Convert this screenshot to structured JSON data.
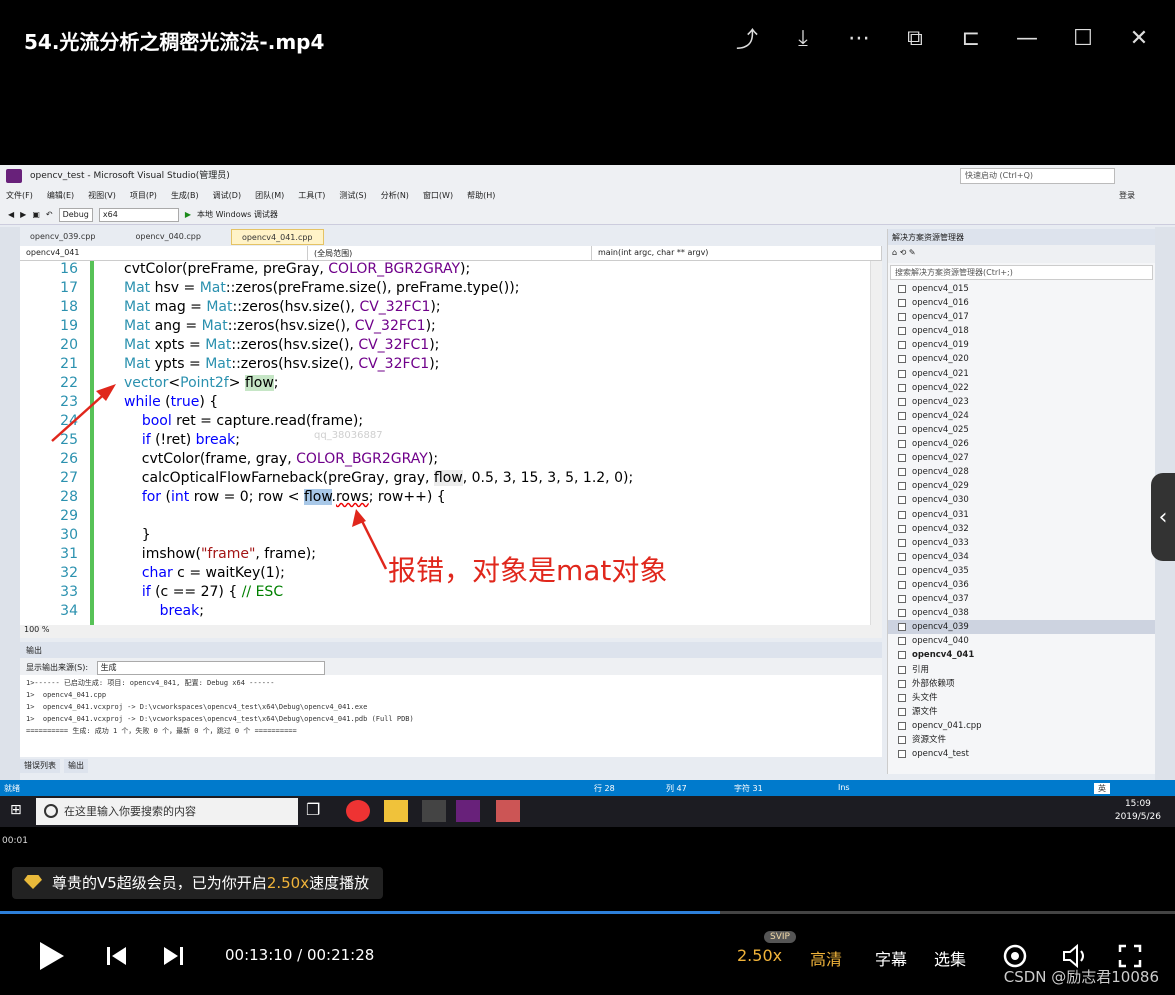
{
  "player": {
    "title": "54.光流分析之稠密光流法-.mp4",
    "icons": [
      "share-icon",
      "download-icon",
      "more-icon",
      "pip-icon",
      "pin-icon",
      "minimize-icon",
      "maximize-icon",
      "close-icon"
    ],
    "current_time": "00:13:10",
    "total_time": "00:21:28",
    "time_display": "00:13:10 / 00:21:28",
    "small_time": "00:01",
    "progress": 0.613,
    "vip_toast_prefix": "尊贵的V5超级会员，已为你开启",
    "vip_toast_speed": "2.50x",
    "vip_toast_suffix": "速度播放",
    "speed_label": "2.50x",
    "svip_badge": "SVIP",
    "quality_label": "高清",
    "subtitle_label": "字幕",
    "episodes_label": "选集",
    "watermark": "CSDN @励志君10086"
  },
  "vs": {
    "window_title": "opencv_test - Microsoft Visual Studio(管理员)",
    "quick_launch": "快速启动 (Ctrl+Q)",
    "login": "登录",
    "menu": [
      "文件(F)",
      "编辑(E)",
      "视图(V)",
      "项目(P)",
      "生成(B)",
      "调试(D)",
      "团队(M)",
      "工具(T)",
      "测试(S)",
      "分析(N)",
      "窗口(W)",
      "帮助(H)"
    ],
    "config": "Debug",
    "platform": "x64",
    "run_label": "本地 Windows 调试器",
    "tabs": [
      "opencv_039.cpp",
      "opencv_040.cpp",
      "opencv4_041.cpp"
    ],
    "nav_project": "opencv4_041",
    "nav_scope": "(全局范围)",
    "nav_func": "main(int argc, char ** argv)",
    "zoom": "100 %",
    "code_watermark": "qq_38036887",
    "output": {
      "title": "输出",
      "source_label": "显示输出来源(S):",
      "source_value": "生成",
      "lines": [
        "1>------ 已启动生成: 项目: opencv4_041, 配置: Debug x64 ------",
        "1>  opencv4_041.cpp",
        "1>  opencv4_041.vcxproj -> D:\\vcworkspaces\\opencv4_test\\x64\\Debug\\opencv4_041.exe",
        "1>  opencv4_041.vcxproj -> D:\\vcworkspaces\\opencv4_test\\x64\\Debug\\opencv4_041.pdb (Full PDB)",
        "========== 生成: 成功 1 个，失败 0 个，最新 0 个，跳过 0 个 =========="
      ],
      "tabs": [
        "错误列表",
        "输出"
      ]
    },
    "solution": {
      "title": "解决方案资源管理器",
      "search": "搜索解决方案资源管理器(Ctrl+;)",
      "items": [
        "opencv4_015",
        "opencv4_016",
        "opencv4_017",
        "opencv4_018",
        "opencv4_019",
        "opencv4_020",
        "opencv4_021",
        "opencv4_022",
        "opencv4_023",
        "opencv4_024",
        "opencv4_025",
        "opencv4_026",
        "opencv4_027",
        "opencv4_028",
        "opencv4_029",
        "opencv4_030",
        "opencv4_031",
        "opencv4_032",
        "opencv4_033",
        "opencv4_034",
        "opencv4_035",
        "opencv4_036",
        "opencv4_037",
        "opencv4_038",
        "opencv4_039",
        "opencv4_040",
        "opencv4_041",
        "引用",
        "外部依赖项",
        "头文件",
        "源文件",
        "opencv_041.cpp",
        "资源文件",
        "opencv4_test"
      ]
    },
    "status": {
      "ready": "就绪",
      "row": "行 28",
      "col": "列 47",
      "char": "字符 31",
      "mode": "Ins"
    },
    "taskbar": {
      "search": "在这里输入你要搜索的内容",
      "time": "15:09",
      "date": "2019/5/26",
      "ime": "英"
    },
    "annotation": "报错，对象是mat对象"
  }
}
